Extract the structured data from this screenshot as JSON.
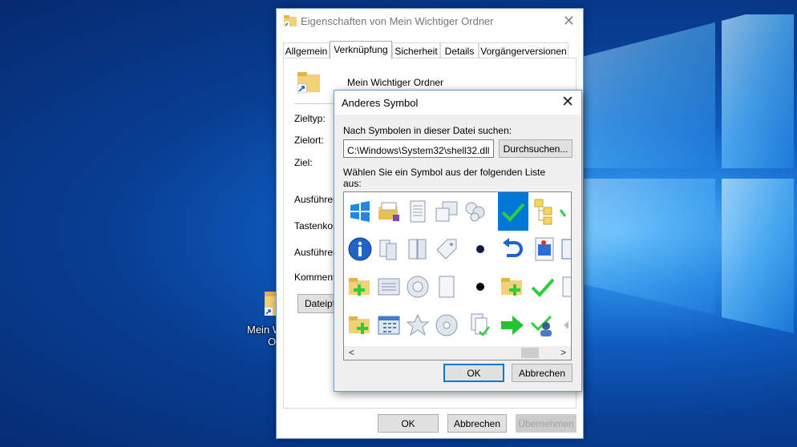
{
  "desktop": {
    "shortcut_label_line1": "Mein W",
    "shortcut_label_line2": "O"
  },
  "properties_dialog": {
    "title": "Eigenschaften von Mein Wichtiger Ordner",
    "close_glyph": "✕",
    "tabs": [
      {
        "label": "Allgemein",
        "active": false
      },
      {
        "label": "Verknüpfung",
        "active": true
      },
      {
        "label": "Sicherheit",
        "active": false
      },
      {
        "label": "Details",
        "active": false
      },
      {
        "label": "Vorgängerversionen",
        "active": false
      }
    ],
    "shortcut_name": "Mein Wichtiger Ordner",
    "labels": {
      "zieltyp": "Zieltyp:",
      "zielort": "Zielort:",
      "ziel": "Ziel:",
      "ausfuehren_in": "Ausführen",
      "tastenkombination": "Tastenkom",
      "ausfuehren": "Ausführen",
      "kommentar": "Kommenta"
    },
    "open_file_location_button": "Dateipf",
    "buttons": {
      "ok": "OK",
      "cancel": "Abbrechen",
      "apply": "Übernehmen"
    }
  },
  "change_icon_dialog": {
    "title": "Anderes Symbol",
    "close_glyph": "✕",
    "search_label": "Nach Symbolen in dieser Datei suchen:",
    "path_value": "C:\\Windows\\System32\\shell32.dll",
    "browse_button": "Durchsuchen...",
    "list_label_line1": "Wählen Sie ein Symbol aus der folgenden Liste",
    "list_label_line2": "aus:",
    "selected_icon": "green-check-icon",
    "icon_rows": [
      [
        "windows-logo-icon",
        "folder-files-icon",
        "document-icon",
        "window-copy-icon",
        "people-icon",
        "green-check-icon",
        "folder-tree-icon",
        "green-check-icon"
      ],
      [
        "info-icon",
        "pages-icon",
        "columns-icon",
        "tag-icon",
        "dot-icon",
        "undo-icon",
        "media-file-icon",
        "scroll-icon"
      ],
      [
        "folder-add-icon",
        "list-window-icon",
        "disc-icon",
        "blank-page-icon",
        "dot-icon",
        "folder-add-icon",
        "green-check-icon",
        "page-icon"
      ],
      [
        "folder-add-icon",
        "calendar-grid-icon",
        "star-icon",
        "cd-icon",
        "page-check-icon",
        "green-arrow-icon",
        "user-check-icon",
        "arrow-icon"
      ]
    ],
    "scroll_left": "<",
    "scroll_right": ">",
    "buttons": {
      "ok": "OK",
      "cancel": "Abbrechen"
    }
  }
}
